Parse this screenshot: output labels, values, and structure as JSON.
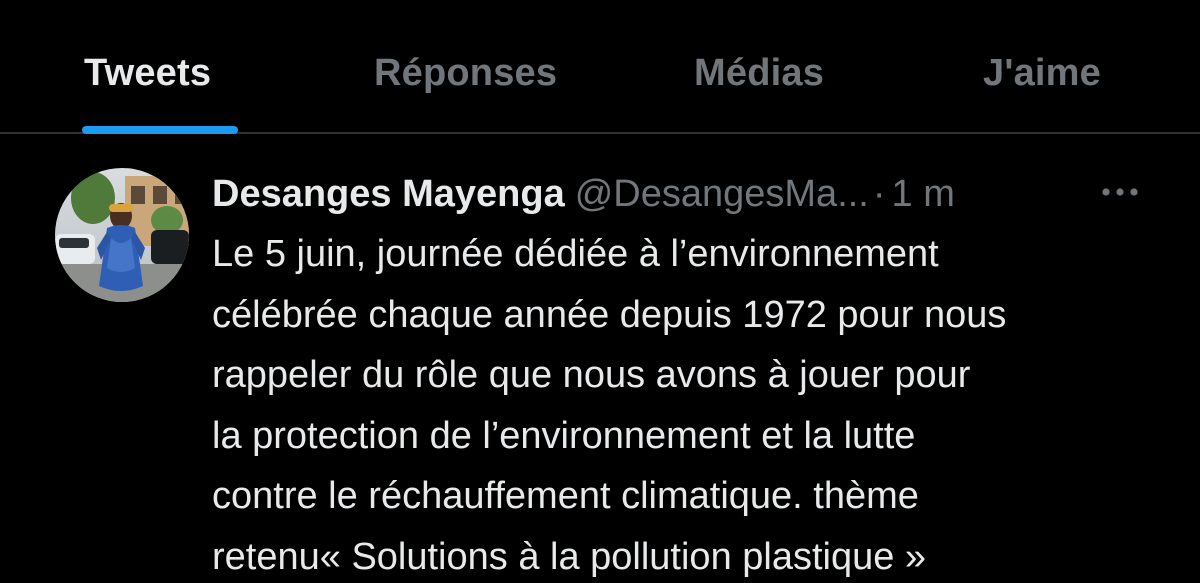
{
  "tabs": {
    "tweets": "Tweets",
    "replies": "Réponses",
    "media": "Médias",
    "likes": "J'aime"
  },
  "tweet": {
    "author_name": "Desanges Mayenga",
    "author_handle": "@DesangesMa...",
    "separator": "·",
    "timestamp": "1 m",
    "text_lines": [
      "Le 5 juin, journée dédiée à l’environnement",
      "célébrée chaque année depuis 1972 pour nous",
      "rappeler du rôle que nous avons à jouer pour",
      "la protection de l’environnement et la lutte",
      "contre le réchauffement climatique. thème",
      "retenu« Solutions à la pollution plastique »"
    ],
    "icons": {
      "avatar": "profile-photo",
      "more": "more-horizontal-icon"
    }
  },
  "colors": {
    "background": "#000000",
    "primary_text": "#e7e9ea",
    "secondary_text": "#71767b",
    "accent": "#1d9bf0",
    "divider": "#2f3336"
  }
}
